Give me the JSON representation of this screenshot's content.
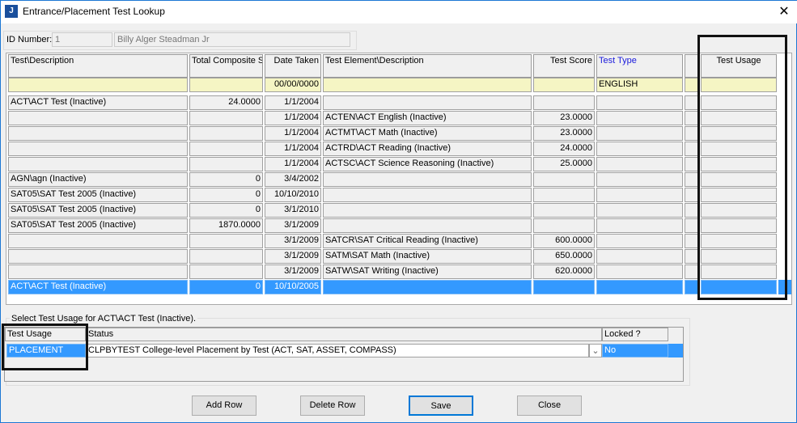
{
  "window": {
    "title": "Entrance/Placement Test Lookup",
    "icon": "app-logo-icon",
    "close": "✕"
  },
  "id": {
    "label": "ID Number:",
    "value": "1",
    "name": "Billy Alger Steadman Jr"
  },
  "grid": {
    "headers": [
      "Test\\Description",
      "Total Composite Score",
      "Date Taken",
      "Test Element\\Description",
      "Test Score",
      "Test Type",
      "",
      "Test Usage"
    ],
    "header_test_type_color": "#1a1adc",
    "filter": [
      "",
      "",
      "00/00/0000",
      "",
      "",
      "ENGLISH",
      "",
      ""
    ],
    "rows": [
      [
        "ACT\\ACT Test (Inactive)",
        "24.0000",
        "1/1/2004",
        "",
        "",
        "",
        "",
        ""
      ],
      [
        "",
        "",
        "1/1/2004",
        "ACTEN\\ACT English (Inactive)",
        "23.0000",
        "",
        "",
        ""
      ],
      [
        "",
        "",
        "1/1/2004",
        "ACTMT\\ACT Math (Inactive)",
        "23.0000",
        "",
        "",
        ""
      ],
      [
        "",
        "",
        "1/1/2004",
        "ACTRD\\ACT Reading (Inactive)",
        "24.0000",
        "",
        "",
        ""
      ],
      [
        "",
        "",
        "1/1/2004",
        "ACTSC\\ACT Science Reasoning (Inactive)",
        "25.0000",
        "",
        "",
        ""
      ],
      [
        "AGN\\agn (Inactive)",
        "0",
        "3/4/2002",
        "",
        "",
        "",
        "",
        ""
      ],
      [
        "SAT05\\SAT Test 2005 (Inactive)",
        "0",
        "10/10/2010",
        "",
        "",
        "",
        "",
        ""
      ],
      [
        "SAT05\\SAT Test 2005 (Inactive)",
        "0",
        "3/1/2010",
        "",
        "",
        "",
        "",
        ""
      ],
      [
        "SAT05\\SAT Test 2005 (Inactive)",
        "1870.0000",
        "3/1/2009",
        "",
        "",
        "",
        "",
        ""
      ],
      [
        "",
        "",
        "3/1/2009",
        "SATCR\\SAT Critical Reading (Inactive)",
        "600.0000",
        "",
        "",
        ""
      ],
      [
        "",
        "",
        "3/1/2009",
        "SATM\\SAT Math (Inactive)",
        "650.0000",
        "",
        "",
        ""
      ],
      [
        "",
        "",
        "3/1/2009",
        "SATW\\SAT Writing (Inactive)",
        "620.0000",
        "",
        "",
        ""
      ],
      [
        "ACT\\ACT Test (Inactive)",
        "0",
        "10/10/2005",
        "",
        "",
        "",
        "",
        ""
      ]
    ],
    "selected_row": 12
  },
  "usage": {
    "group_label": "Select Test Usage for ACT\\ACT Test (Inactive).",
    "headers": [
      "Test Usage",
      "Status",
      "Locked ?"
    ],
    "row": {
      "usage": "PLACEMENT",
      "status": "CLPBYTEST College-level Placement by Test (ACT, SAT, ASSET, COMPASS)",
      "locked": "No"
    }
  },
  "buttons": {
    "add": "Add Row",
    "delete": "Delete Row",
    "save": "Save",
    "close": "Close"
  }
}
